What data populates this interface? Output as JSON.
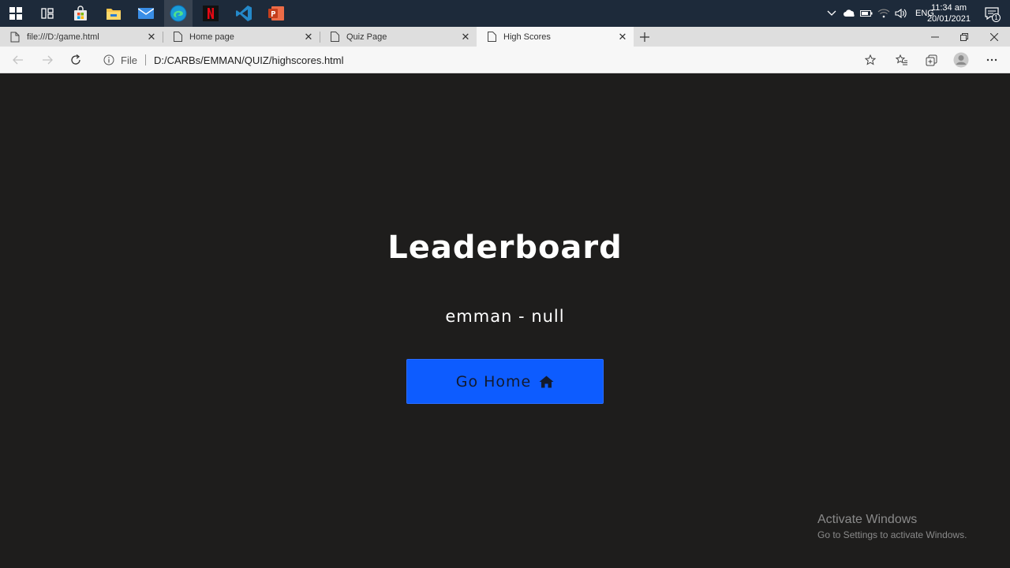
{
  "taskbar": {
    "apps": [
      {
        "name": "start-icon"
      },
      {
        "name": "task-view-icon"
      },
      {
        "name": "store-icon"
      },
      {
        "name": "file-explorer-icon"
      },
      {
        "name": "mail-icon"
      },
      {
        "name": "edge-icon"
      },
      {
        "name": "netflix-icon"
      },
      {
        "name": "vscode-icon"
      },
      {
        "name": "powerpoint-icon"
      }
    ],
    "language": "ENG",
    "time": "11:34 am",
    "date": "20/01/2021",
    "notification_count": "1"
  },
  "tabs": [
    {
      "label": "file:///D:/game.html"
    },
    {
      "label": "Home page"
    },
    {
      "label": "Quiz Page"
    },
    {
      "label": "High Scores"
    }
  ],
  "address": {
    "scheme": "File",
    "url": "D:/CARBs/EMMAN/QUIZ/highscores.html"
  },
  "page": {
    "title": "Leaderboard",
    "score_entry": "emman - null",
    "home_button": "Go Home"
  },
  "watermark": {
    "title": "Activate Windows",
    "subtitle": "Go to Settings to activate Windows."
  },
  "colors": {
    "page_bg": "#1e1d1c",
    "button_bg": "#0d5cff",
    "taskbar_bg": "#1d2a3a"
  }
}
